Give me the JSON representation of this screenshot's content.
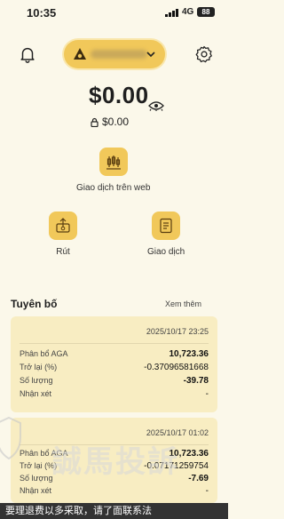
{
  "status_bar": {
    "time": "10:35",
    "network": "4G",
    "battery": "88"
  },
  "header": {
    "account_icons": [
      "bell-icon",
      "settings-icon"
    ],
    "account_name": "xxxxxx"
  },
  "balance": {
    "main": "$0.00",
    "locked": "$0.00"
  },
  "actions": {
    "web_trade": "Giao dịch trên web",
    "withdraw": "Rút",
    "trade": "Giao dịch"
  },
  "statements": {
    "title": "Tuyên bố",
    "see_more": "Xem thêm",
    "cards": [
      {
        "date": "2025/10/17 23:25",
        "rows": [
          {
            "label": "Phân bổ AGA",
            "value": "10,723.36"
          },
          {
            "label": "Trở lại (%)",
            "value": "-0.37096581668"
          },
          {
            "label": "Số lượng",
            "value": "-39.78"
          },
          {
            "label": "Nhận xét",
            "value": "-"
          }
        ]
      },
      {
        "date": "2025/10/17 01:02",
        "rows": [
          {
            "label": "Phân bổ AGA",
            "value": "10,723.36"
          },
          {
            "label": "Trở lại (%)",
            "value": "-0.07171259754"
          },
          {
            "label": "Số lượng",
            "value": "-7.69"
          },
          {
            "label": "Nhận xét",
            "value": "-"
          }
        ]
      }
    ]
  },
  "watermark": "誠馬投訴",
  "bottom_banner": "要理退费以多采取，请了面联系法"
}
